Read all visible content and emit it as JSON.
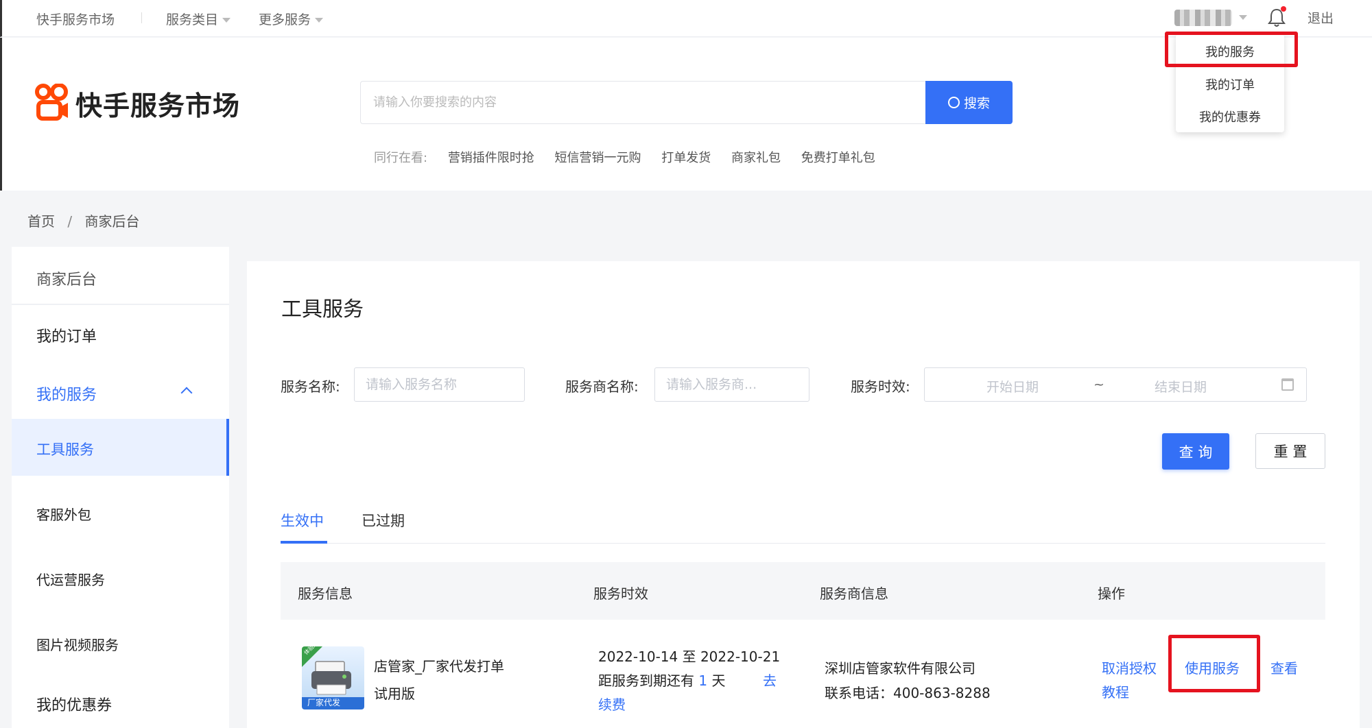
{
  "topbar": {
    "market": "快手服务市场",
    "categories": "服务类目",
    "more": "更多服务",
    "logout": "退出"
  },
  "dropdown": {
    "items": [
      "我的服务",
      "我的订单",
      "我的优惠券"
    ]
  },
  "header": {
    "logo_text": "快手服务市场",
    "search_placeholder": "请输入你要搜索的内容",
    "search_button": "搜索",
    "hot_prefix": "同行在看:",
    "hot_tags": [
      "营销插件限时抢",
      "短信营销一元购",
      "打单发货",
      "商家礼包",
      "免费打单礼包"
    ]
  },
  "breadcrumb": {
    "home": "首页",
    "sep": "/",
    "current": "商家后台"
  },
  "sidebar": {
    "items": [
      "商家后台",
      "我的订单",
      "我的服务",
      "工具服务",
      "客服外包",
      "代运营服务",
      "图片视频服务",
      "我的优惠券"
    ]
  },
  "main": {
    "title": "工具服务",
    "filters": {
      "name_label": "服务名称:",
      "name_placeholder": "请输入服务名称",
      "vendor_label": "服务商名称:",
      "vendor_placeholder": "请输入服务商...",
      "period_label": "服务时效:",
      "start_placeholder": "开始日期",
      "range_sep": "~",
      "end_placeholder": "结束日期"
    },
    "query_button": "查 询",
    "reset_button": "重 置",
    "tabs": [
      "生效中",
      "已过期"
    ],
    "columns": [
      "服务信息",
      "服务时效",
      "服务商信息",
      "操作"
    ],
    "row": {
      "product_name": "店管家_厂家代发打单",
      "product_edition": "试用版",
      "image_badge": "厂家代发",
      "image_corner": "体验版",
      "date_range": "2022-10-14 至 2022-10-21",
      "expire_prefix": "距服务到期还有",
      "expire_days": "1",
      "expire_unit": "天",
      "renew_part1": "去",
      "renew_part2": "续费",
      "vendor_name": "深圳店管家软件有限公司",
      "vendor_phone": "联系电话：400-863-8288",
      "action_cancel_1": "取消授权",
      "action_cancel_2": "教程",
      "action_use": "使用服务",
      "action_view": "查看"
    }
  },
  "colors": {
    "primary": "#3470f6",
    "highlight_red": "#e5131f",
    "brand_orange": "#ff4906"
  }
}
